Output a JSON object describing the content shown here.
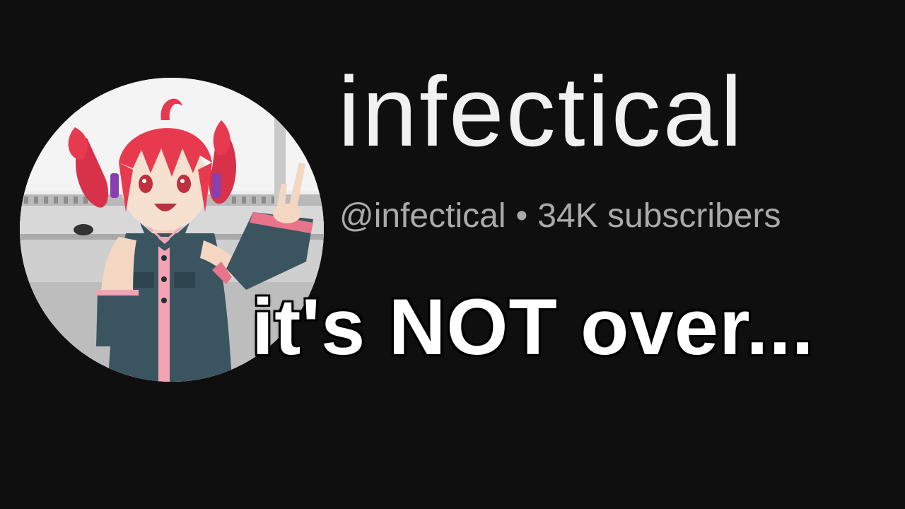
{
  "channel": {
    "name": "infectical",
    "handle": "@infectical",
    "separator": "•",
    "subscribers": "34K subscribers"
  },
  "caption": {
    "text": "it's NOT over..."
  },
  "avatar": {
    "icon": "anime-character-avatar",
    "hair_color": "#e83a4f",
    "outfit_color": "#3b5560",
    "accent_color": "#f2a3b4"
  },
  "colors": {
    "background": "#0f0f0f",
    "title": "#f1f1f1",
    "meta": "#aaaaaa",
    "caption": "#ffffff"
  }
}
